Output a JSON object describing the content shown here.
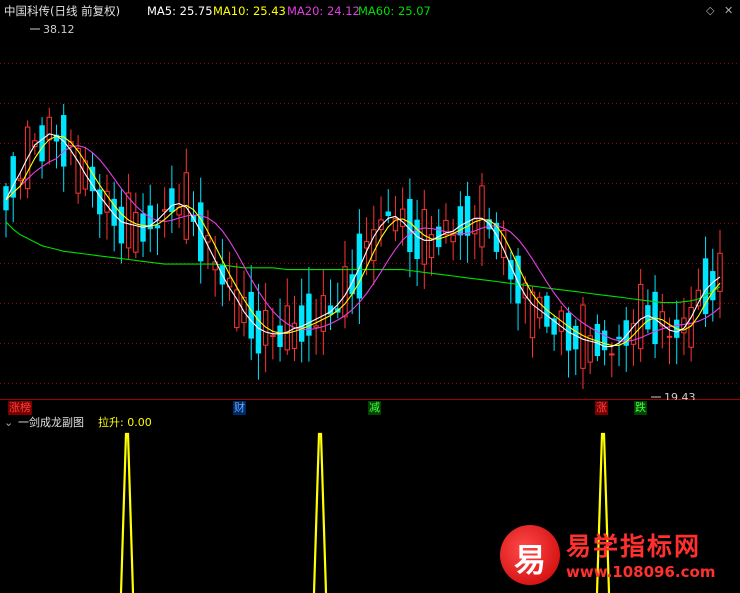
{
  "header": {
    "title": "中国科传(日线 前复权)",
    "ma5": "MA5: 25.75",
    "ma10": "MA10: 25.43",
    "ma20": "MA20: 24.12",
    "ma60": "MA60: 25.07",
    "icons": [
      "diamond-icon",
      "close-icon"
    ]
  },
  "annotations": {
    "high_label": "38.12",
    "low_label": "19.43"
  },
  "events": [
    {
      "label": "涨榜",
      "color": "#ff4040",
      "bg": "#7a0000"
    },
    {
      "label": "财",
      "color": "#66aaff",
      "bg": "#002a66"
    },
    {
      "label": "减",
      "color": "#40ff40",
      "bg": "#004400"
    },
    {
      "label": "涨",
      "color": "#ff4040",
      "bg": "#7a0000"
    },
    {
      "label": "跌",
      "color": "#40ff40",
      "bg": "#004400"
    }
  ],
  "sub_panel": {
    "title": "一剑成龙副图",
    "value_text": "拉升: 0.00"
  },
  "watermark": {
    "char": "易",
    "title": "易学指标网",
    "url": "www.108096.com"
  },
  "colors": {
    "up": "#ff3333",
    "down": "#00e5ff",
    "ma5": "#ffffff",
    "ma10": "#ffff00",
    "ma20": "#e040e0",
    "ma60": "#00dd00",
    "grid": "#a00000",
    "signal": "#ffff00"
  },
  "chart_data": {
    "type": "candlestick",
    "ma5": [
      29.8,
      30.6,
      31.3,
      32.1,
      32.8,
      33.1,
      33.4,
      33.3,
      33.0,
      32.5,
      31.9,
      31.2,
      30.6,
      30.0,
      29.5,
      29.0,
      28.6,
      28.5,
      28.4,
      28.3,
      28.4,
      28.7,
      29.1,
      29.5,
      29.6,
      29.4,
      28.8,
      28.1,
      27.3,
      26.5,
      25.7,
      25.0,
      24.4,
      23.7,
      23.2,
      22.8,
      22.6,
      22.5,
      22.5,
      22.6,
      22.8,
      22.9,
      23.1,
      23.3,
      23.5,
      23.7,
      24.1,
      24.6,
      25.3,
      26.1,
      27.0,
      27.8,
      28.4,
      28.8,
      28.9,
      28.6,
      28.2,
      27.8,
      27.6,
      27.6,
      27.8,
      28.0,
      28.1,
      28.4,
      28.6,
      28.8,
      28.8,
      28.5,
      27.9,
      27.1,
      26.2,
      25.3,
      24.6,
      24.1,
      23.8,
      23.5,
      23.2,
      22.9,
      22.6,
      22.4,
      22.2,
      22.1,
      22.0,
      21.8,
      21.8,
      22.0,
      22.4,
      22.9,
      23.3,
      23.5,
      23.3,
      23.0,
      22.7,
      22.6,
      22.8,
      23.4,
      24.2,
      24.9,
      25.3,
      25.6
    ],
    "ma60": [
      28.6,
      28.2,
      27.9,
      27.7,
      27.5,
      27.3,
      27.2,
      27.1,
      27.0,
      26.95,
      26.9,
      26.85,
      26.8,
      26.75,
      26.7,
      26.65,
      26.6,
      26.55,
      26.5,
      26.45,
      26.4,
      26.35,
      26.3,
      26.3,
      26.3,
      26.3,
      26.3,
      26.3,
      26.3,
      26.3,
      26.25,
      26.2,
      26.15,
      26.1,
      26.1,
      26.1,
      26.1,
      26.1,
      26.05,
      26.0,
      26.0,
      26.0,
      26.0,
      26.0,
      26.0,
      26.0,
      26.0,
      26.0,
      26.0,
      26.0,
      26.0,
      26.0,
      26.0,
      26.0,
      26.0,
      26.0,
      25.95,
      25.9,
      25.85,
      25.8,
      25.75,
      25.7,
      25.65,
      25.6,
      25.55,
      25.5,
      25.45,
      25.4,
      25.35,
      25.3,
      25.25,
      25.2,
      25.15,
      25.1,
      25.05,
      25.0,
      24.95,
      24.9,
      24.85,
      24.8,
      24.75,
      24.7,
      24.65,
      24.6,
      24.55,
      24.5,
      24.45,
      24.4,
      24.35,
      24.3,
      24.25,
      24.2,
      24.2,
      24.2,
      24.25,
      24.3,
      24.4,
      24.6,
      24.8,
      25.07
    ],
    "signals": [
      0.0,
      1.0,
      0.0,
      1.0,
      0.0,
      1.0,
      0.0
    ]
  }
}
